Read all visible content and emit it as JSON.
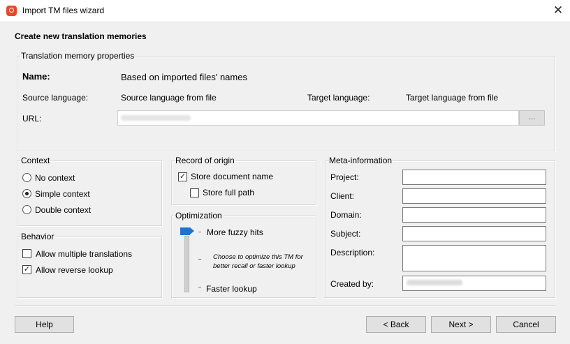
{
  "window": {
    "title": "Import TM files wizard"
  },
  "heading": "Create new translation memories",
  "tm_properties": {
    "group_label": "Translation memory properties",
    "name_label": "Name:",
    "name_value": "Based on imported files' names",
    "source_label": "Source language:",
    "source_value": "Source language from file",
    "target_label": "Target language:",
    "target_value": "Target language from file",
    "url_label": "URL:",
    "browse_label": "..."
  },
  "context": {
    "group_label": "Context",
    "options": [
      {
        "label": "No context",
        "selected": false
      },
      {
        "label": "Simple context",
        "selected": true
      },
      {
        "label": "Double context",
        "selected": false
      }
    ]
  },
  "behavior": {
    "group_label": "Behavior",
    "options": [
      {
        "label": "Allow multiple translations",
        "checked": false
      },
      {
        "label": "Allow reverse lookup",
        "checked": true
      }
    ]
  },
  "record": {
    "group_label": "Record of origin",
    "store_doc": {
      "label": "Store document name",
      "checked": true
    },
    "store_path": {
      "label": "Store full path",
      "checked": false
    }
  },
  "optimization": {
    "group_label": "Optimization",
    "top_label": "More fuzzy hits",
    "hint": "Choose to optimize this TM for better recall or faster lookup",
    "bottom_label": "Faster lookup",
    "level": 0
  },
  "meta": {
    "group_label": "Meta-information",
    "project_label": "Project:",
    "client_label": "Client:",
    "domain_label": "Domain:",
    "subject_label": "Subject:",
    "description_label": "Description:",
    "created_label": "Created by:"
  },
  "buttons": {
    "help": "Help",
    "back": "< Back",
    "next": "Next >",
    "cancel": "Cancel"
  },
  "colors": {
    "accent": "#1e73cf",
    "app_icon": "#e24a2c"
  },
  "check_mark": "✓",
  "close_glyph": "✕"
}
